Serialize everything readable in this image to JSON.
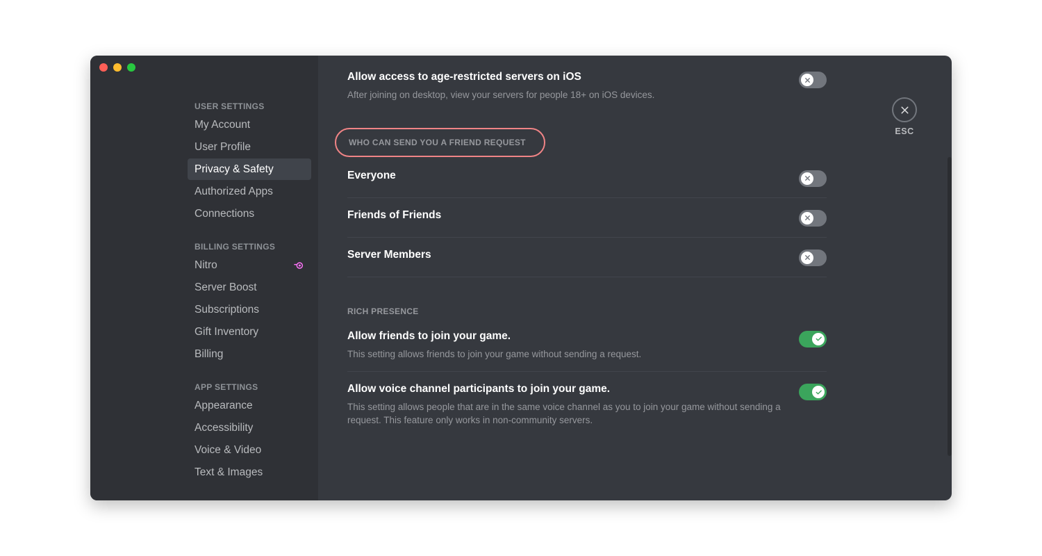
{
  "sidebar": {
    "sections": [
      {
        "header": "USER SETTINGS",
        "items": [
          {
            "label": "My Account"
          },
          {
            "label": "User Profile"
          },
          {
            "label": "Privacy & Safety",
            "active": true
          },
          {
            "label": "Authorized Apps"
          },
          {
            "label": "Connections"
          }
        ]
      },
      {
        "header": "BILLING SETTINGS",
        "items": [
          {
            "label": "Nitro",
            "badge": "nitro"
          },
          {
            "label": "Server Boost"
          },
          {
            "label": "Subscriptions"
          },
          {
            "label": "Gift Inventory"
          },
          {
            "label": "Billing"
          }
        ]
      },
      {
        "header": "APP SETTINGS",
        "items": [
          {
            "label": "Appearance"
          },
          {
            "label": "Accessibility"
          },
          {
            "label": "Voice & Video"
          },
          {
            "label": "Text & Images"
          }
        ]
      }
    ]
  },
  "close": {
    "label": "ESC"
  },
  "content": {
    "top": {
      "title": "Allow access to age-restricted servers on iOS",
      "desc": "After joining on desktop, view your servers for people 18+ on iOS devices.",
      "toggle": "off"
    },
    "friend_header": "WHO CAN SEND YOU A FRIEND REQUEST",
    "friend_rows": [
      {
        "title": "Everyone",
        "toggle": "off"
      },
      {
        "title": "Friends of Friends",
        "toggle": "off"
      },
      {
        "title": "Server Members",
        "toggle": "off"
      }
    ],
    "rich_header": "RICH PRESENCE",
    "rich_rows": [
      {
        "title": "Allow friends to join your game.",
        "desc": "This setting allows friends to join your game without sending a request.",
        "toggle": "on"
      },
      {
        "title": "Allow voice channel participants to join your game.",
        "desc": "This setting allows people that are in the same voice channel as you to join your game without sending a request. This feature only works in non-community servers.",
        "toggle": "on"
      }
    ]
  },
  "colors": {
    "nitro_badge": "#ff73fa"
  }
}
